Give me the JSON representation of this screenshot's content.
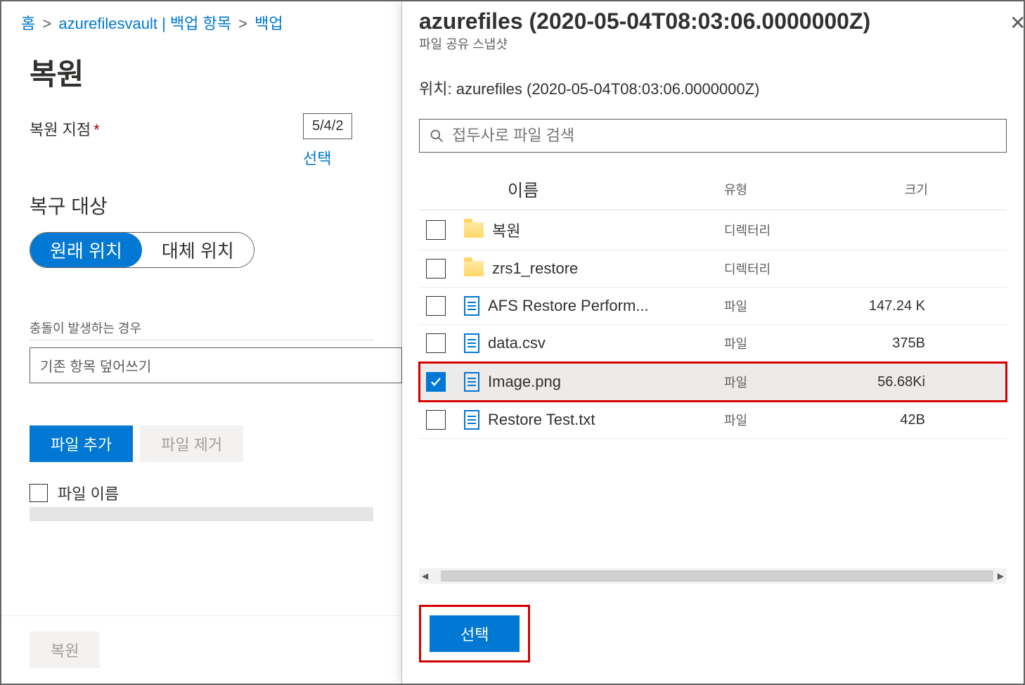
{
  "breadcrumb": {
    "home": "홈",
    "vault": "azurefilesvault | 백업 항목",
    "last": "백업"
  },
  "left": {
    "title": "복원",
    "restore_point_label": "복원 지점",
    "restore_point_value": "5/4/2",
    "select_link": "선택",
    "recovery_target_title": "복구 대상",
    "location_original": "원래 위치",
    "location_alt": "대체 위치",
    "conflict_label": "충돌이 발생하는 경우",
    "conflict_value": "기존 항목 덮어쓰기",
    "add_file": "파일 추가",
    "remove_file": "파일 제거",
    "file_name_label": "파일 이름",
    "restore_btn": "복원"
  },
  "right": {
    "title": "azurefiles (2020-05-04T08:03:06.0000000Z)",
    "subtitle": "파일 공유 스냅샷",
    "location_prefix": "위치: ",
    "location_value": "azurefiles (2020-05-04T08:03:06.0000000Z)",
    "search_placeholder": "접두사로 파일 검색",
    "col_name": "이름",
    "col_type": "유형",
    "col_size": "크기",
    "rows": [
      {
        "name": "복원",
        "type": "디렉터리",
        "size": "",
        "kind": "folder",
        "checked": false
      },
      {
        "name": "zrs1_restore",
        "type": "디렉터리",
        "size": "",
        "kind": "folder",
        "checked": false
      },
      {
        "name": "AFS Restore Perform...",
        "type": "파일",
        "size": "147.24 K",
        "kind": "file",
        "checked": false
      },
      {
        "name": "data.csv",
        "type": "파일",
        "size": "375B",
        "kind": "file",
        "checked": false
      },
      {
        "name": "Image.png",
        "type": "파일",
        "size": "56.68Ki",
        "kind": "file",
        "checked": true
      },
      {
        "name": "Restore Test.txt",
        "type": "파일",
        "size": "42B",
        "kind": "file",
        "checked": false
      }
    ],
    "select_btn": "선택"
  }
}
